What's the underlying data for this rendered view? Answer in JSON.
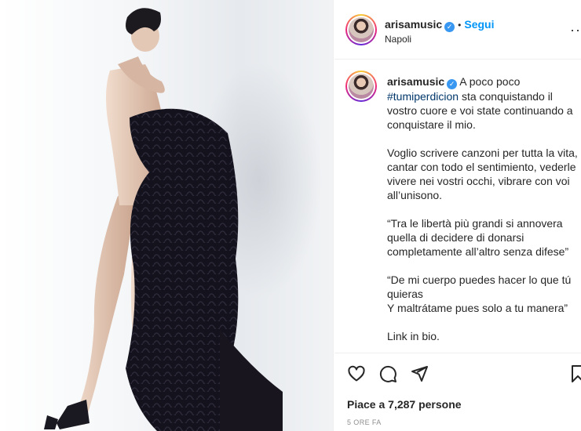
{
  "post": {
    "author": {
      "username": "arisamusic",
      "verified": true,
      "follow_label": "Segui",
      "separator": "•",
      "location": "Napoli"
    },
    "more_icon": "more-options-icon",
    "caption": {
      "username": "arisamusic",
      "first_line": "A poco poco",
      "hashtag": "#tumiperdicion",
      "first_rest": "sta conquistando il vostro cuore e voi state continuando a conquistare il mio.",
      "paragraph2": "Voglio scrivere canzoni per tutta la vita, cantar con todo el sentimiento, vederle vivere nei vostri occhi, vibrare con voi all’unisono.",
      "paragraph3": "“Tra le libertà più grandi si annovera quella di decidere di donarsi completamente all’altro senza difese”",
      "paragraph4_line1": "“De mi cuerpo puedes hacer lo que tú quieras",
      "paragraph4_line2": "Y maltrátame pues solo a tu manera”",
      "paragraph5": "Link in bio."
    },
    "actions": {
      "like_icon": "heart-icon",
      "comment_icon": "comment-icon",
      "share_icon": "share-icon",
      "save_icon": "bookmark-icon"
    },
    "likes_text": "Piace a 7,287 persone",
    "time_ago": "5 ORE FA"
  },
  "colors": {
    "accent": "#0095f6",
    "verified": "#3897f0",
    "text": "#262626",
    "muted": "#8e8e8e",
    "hashtag": "#00376b"
  }
}
